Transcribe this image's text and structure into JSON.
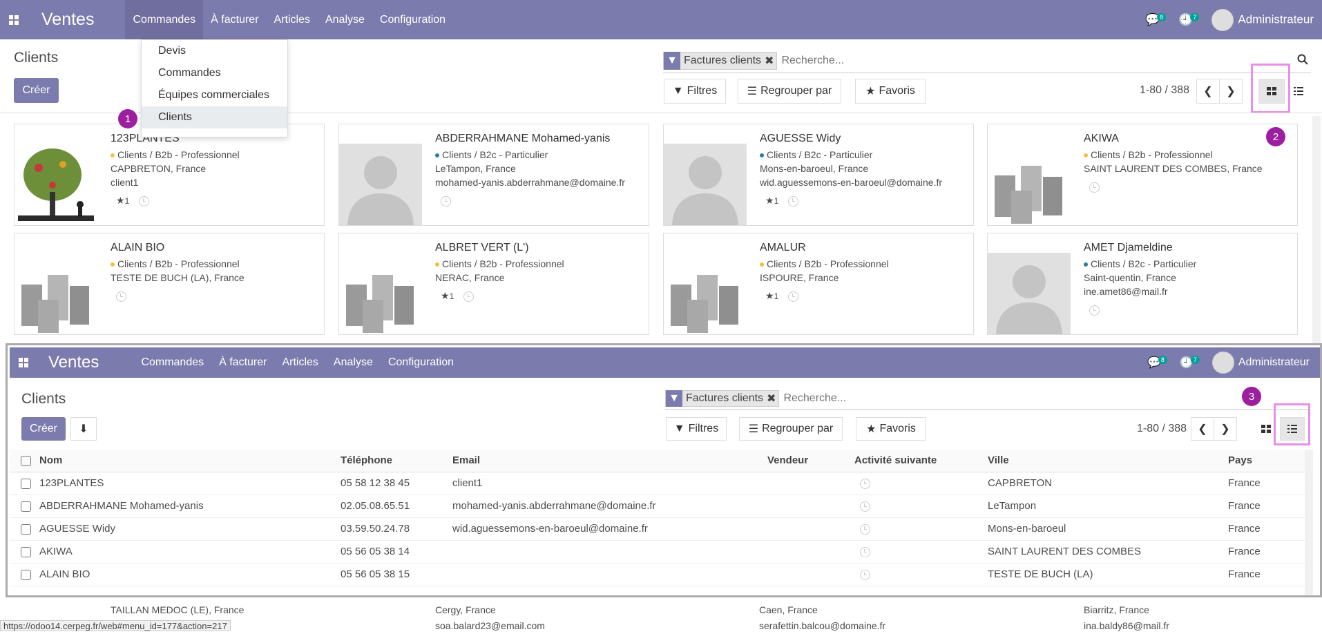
{
  "app": {
    "brand": "Ventes",
    "menu": [
      "Commandes",
      "À facturer",
      "Articles",
      "Analyse",
      "Configuration"
    ],
    "messages_count": "8",
    "activities_count": "7",
    "user": "Administrateur"
  },
  "dropdown": {
    "items": [
      "Devis",
      "Commandes",
      "Équipes commerciales",
      "Clients"
    ],
    "active": "Clients"
  },
  "page": {
    "title": "Clients",
    "create_label": "Créer",
    "facet_label": "Factures clients",
    "search_placeholder": "Recherche...",
    "filters_label": "Filtres",
    "group_label": "Regrouper par",
    "favorites_label": "Favoris",
    "pager": "1-80 / 388"
  },
  "markers": [
    "1",
    "2",
    "3"
  ],
  "cards": [
    {
      "name": "123PLANTES",
      "tag": "Clients / B2b - Professionnel",
      "tag_color": "#f0c040",
      "line1": "CAPBRETON, France",
      "line2": "client1",
      "stars": "1",
      "img": "tree"
    },
    {
      "name": "ABDERRAHMANE Mohamed-yanis",
      "tag": "Clients / B2c - Particulier",
      "tag_color": "#2b7ea1",
      "line1": "LeTampon, France",
      "line2": "mohamed-yanis.abderrahmane@domaine.fr",
      "stars": "",
      "img": "person"
    },
    {
      "name": "AGUESSE Widy",
      "tag": "Clients / B2c - Particulier",
      "tag_color": "#2b7ea1",
      "line1": "Mons-en-baroeul, France",
      "line2": "wid.aguessemons-en-baroeul@domaine.fr",
      "stars": "1",
      "img": "person"
    },
    {
      "name": "AKIWA",
      "tag": "Clients / B2b - Professionnel",
      "tag_color": "#f0c040",
      "line1": "SAINT LAURENT DES COMBES, France",
      "line2": "",
      "stars": "",
      "img": "building"
    },
    {
      "name": "ALAIN BIO",
      "tag": "Clients / B2b - Professionnel",
      "tag_color": "#f0c040",
      "line1": "TESTE DE BUCH (LA), France",
      "line2": "",
      "stars": "",
      "img": "building"
    },
    {
      "name": "ALBRET VERT (L')",
      "tag": "Clients / B2b - Professionnel",
      "tag_color": "#f0c040",
      "line1": "NERAC, France",
      "line2": "",
      "stars": "1",
      "img": "building"
    },
    {
      "name": "AMALUR",
      "tag": "Clients / B2b - Professionnel",
      "tag_color": "#f0c040",
      "line1": "ISPOURE, France",
      "line2": "",
      "stars": "1",
      "img": "building"
    },
    {
      "name": "AMET Djameldine",
      "tag": "Clients / B2c - Particulier",
      "tag_color": "#2b7ea1",
      "line1": "Saint-quentin, France",
      "line2": "ine.amet86@mail.fr",
      "stars": "",
      "img": "person"
    }
  ],
  "bottom_cards": [
    {
      "line1": "TAILLAN MEDOC (LE), France",
      "line2": ""
    },
    {
      "line1": "Cergy, France",
      "line2": "soa.balard23@email.com"
    },
    {
      "line1": "Caen, France",
      "line2": "serafettin.balcou@domaine.fr"
    },
    {
      "line1": "Biarritz, France",
      "line2": "ina.baldy86@mail.fr"
    }
  ],
  "table": {
    "columns": [
      "Nom",
      "Téléphone",
      "Email",
      "Vendeur",
      "Activité suivante",
      "Ville",
      "Pays"
    ],
    "rows": [
      [
        "123PLANTES",
        "05 58 12 38 45",
        "client1",
        "",
        "",
        "CAPBRETON",
        "France"
      ],
      [
        "ABDERRAHMANE Mohamed-yanis",
        "02.05.08.65.51",
        "mohamed-yanis.abderrahmane@domaine.fr",
        "",
        "",
        "LeTampon",
        "France"
      ],
      [
        "AGUESSE Widy",
        "03.59.50.24.78",
        "wid.aguessemons-en-baroeul@domaine.fr",
        "",
        "",
        "Mons-en-baroeul",
        "France"
      ],
      [
        "AKIWA",
        "05 56 05 38 14",
        "",
        "",
        "",
        "SAINT LAURENT DES COMBES",
        "France"
      ],
      [
        "ALAIN BIO",
        "05 56 05 38 15",
        "",
        "",
        "",
        "TESTE DE BUCH (LA)",
        "France"
      ]
    ]
  },
  "status_url": "https://odoo14.cerpeg.fr/web#menu_id=177&action=217"
}
